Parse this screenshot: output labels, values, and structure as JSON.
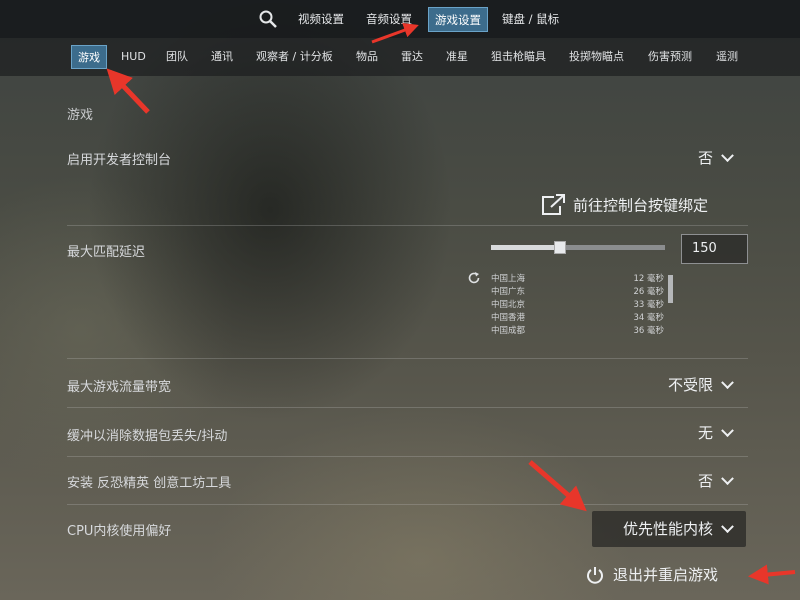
{
  "topnav": {
    "tabs": [
      {
        "label": "视频设置"
      },
      {
        "label": "音频设置"
      },
      {
        "label": "游戏设置"
      },
      {
        "label": "键盘 / 鼠标"
      }
    ],
    "active_index": 2
  },
  "subnav": {
    "tabs": [
      {
        "label": "游戏"
      },
      {
        "label": "HUD"
      },
      {
        "label": "团队"
      },
      {
        "label": "通讯"
      },
      {
        "label": "观察者 / 计分板"
      },
      {
        "label": "物品"
      },
      {
        "label": "雷达"
      },
      {
        "label": "准星"
      },
      {
        "label": "狙击枪瞄具"
      },
      {
        "label": "投掷物瞄点"
      },
      {
        "label": "伤害预测"
      },
      {
        "label": "遥测"
      }
    ],
    "active_index": 0
  },
  "content": {
    "section_title": "游戏",
    "dev_console": {
      "label": "启用开发者控制台",
      "value": "否"
    },
    "console_binding_link": "前往控制台按键绑定",
    "max_ping": {
      "label": "最大匹配延迟",
      "value": "150",
      "slider_fraction": 0.4
    },
    "servers": [
      {
        "name": "中国上海",
        "ping": "12 毫秒"
      },
      {
        "name": "中国广东",
        "ping": "26 毫秒"
      },
      {
        "name": "中国北京",
        "ping": "33 毫秒"
      },
      {
        "name": "中国香港",
        "ping": "34 毫秒"
      },
      {
        "name": "中国成都",
        "ping": "36 毫秒"
      }
    ],
    "bandwidth": {
      "label": "最大游戏流量带宽",
      "value": "不受限"
    },
    "buffer": {
      "label": "缓冲以消除数据包丢失/抖动",
      "value": "无"
    },
    "workshop": {
      "label": "安装 反恐精英 创意工坊工具",
      "value": "否"
    },
    "cpu_pref": {
      "label": "CPU内核使用偏好",
      "value": "优先性能内核"
    },
    "restart_button": "退出并重启游戏"
  },
  "colors": {
    "active_tab": "#3c6c8c",
    "annotation_arrow": "#e8362a"
  },
  "icons": [
    "search-icon",
    "external-link-icon",
    "refresh-icon",
    "power-icon",
    "chevron-down-icon"
  ]
}
